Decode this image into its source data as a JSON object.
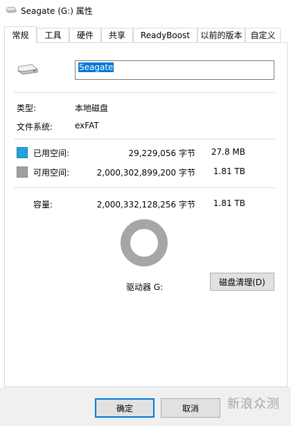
{
  "window": {
    "title": "Seagate (G:) 属性"
  },
  "tabs": [
    {
      "label": "常规",
      "active": true
    },
    {
      "label": "工具"
    },
    {
      "label": "硬件"
    },
    {
      "label": "共享"
    },
    {
      "label": "ReadyBoost"
    },
    {
      "label": "以前的版本"
    },
    {
      "label": "自定义"
    }
  ],
  "general": {
    "name_value": "Seagate",
    "type_label": "类型:",
    "type_value": "本地磁盘",
    "fs_label": "文件系统:",
    "fs_value": "exFAT",
    "used_label": "已用空间:",
    "used_bytes": "29,229,056 字节",
    "used_size": "27.8 MB",
    "free_label": "可用空间:",
    "free_bytes": "2,000,302,899,200 字节",
    "free_size": "1.81 TB",
    "capacity_label": "容量:",
    "capacity_bytes": "2,000,332,128,256 字节",
    "capacity_size": "1.81 TB",
    "drive_label": "驱动器 G:",
    "cleanup_button": "磁盘清理(D)"
  },
  "colors": {
    "used": "#26a0da",
    "free": "#a0a0a0",
    "accent": "#0078d7"
  },
  "buttons": {
    "ok": "确定",
    "cancel": "取消"
  },
  "watermark": "新浪众测"
}
